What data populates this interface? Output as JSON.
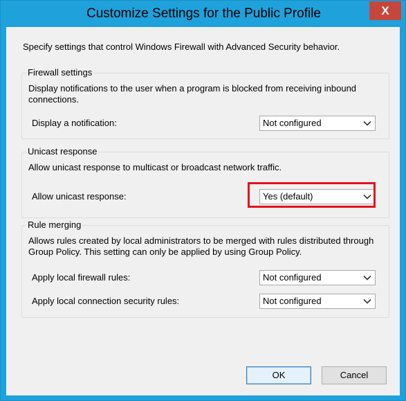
{
  "window": {
    "title": "Customize Settings for the Public Profile",
    "close_glyph": "X"
  },
  "intro": "Specify settings that control Windows Firewall with Advanced Security behavior.",
  "firewall_settings": {
    "title": "Firewall settings",
    "description": "Display notifications to the user when a program is blocked from receiving inbound connections.",
    "display_notification": {
      "label": "Display a notification:",
      "value": "Not configured"
    }
  },
  "unicast_response": {
    "title": "Unicast response",
    "description": "Allow unicast response to multicast or broadcast network traffic.",
    "allow_unicast": {
      "label": "Allow unicast response:",
      "value": "Yes (default)"
    }
  },
  "rule_merging": {
    "title": "Rule merging",
    "description": "Allows rules created by local administrators to be merged with rules distributed through Group Policy. This setting can only be applied by using Group Policy.",
    "apply_local_firewall": {
      "label": "Apply local firewall rules:",
      "value": "Not configured"
    },
    "apply_local_connection_security": {
      "label": "Apply local connection security rules:",
      "value": "Not configured"
    }
  },
  "buttons": {
    "ok": "OK",
    "cancel": "Cancel"
  },
  "colors": {
    "frame": "#1fa1db",
    "close_button": "#c7463b",
    "highlight": "#e3111c",
    "client_background": "#f0f0f0"
  },
  "icons": {
    "dropdown": "chevron-down-icon"
  }
}
